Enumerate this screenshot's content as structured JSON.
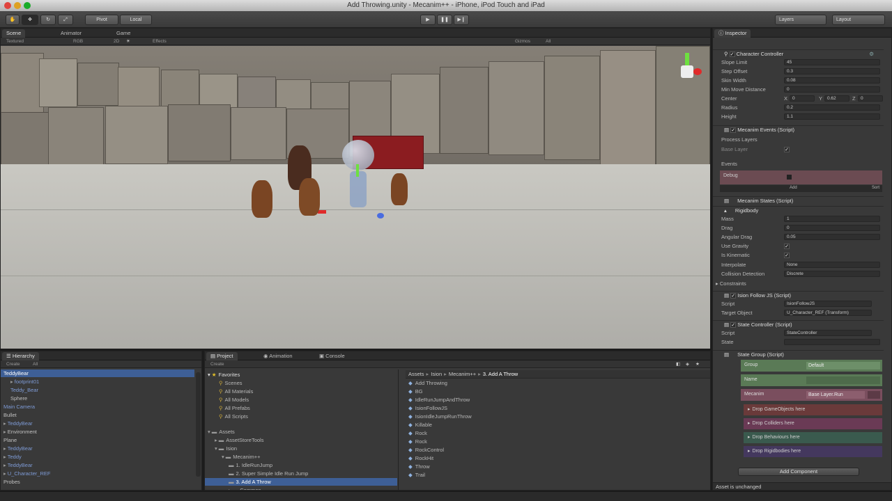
{
  "window": {
    "title": "Add Throwing.unity - Mecanim++ - iPhone, iPod Touch and iPad"
  },
  "toolbar": {
    "pivot_label": "Pivot",
    "local_label": "Local",
    "layers_label": "Layers",
    "layout_label": "Layout"
  },
  "scene_view": {
    "tabs": [
      "Scene",
      "Animator",
      "Game"
    ],
    "shading_mode": "Textured",
    "render_mode": "RGB",
    "mode_2d": "2D",
    "effects_label": "Effects",
    "gizmos_label": "Gizmos",
    "search_placeholder": "All"
  },
  "hierarchy": {
    "tab": "Hierarchy",
    "create_label": "Create",
    "search_placeholder": "All",
    "items": [
      {
        "label": "TeddyBear",
        "selected": true,
        "prefab": false,
        "arrow": "",
        "indent": 0
      },
      {
        "label": "footprint01",
        "selected": false,
        "prefab": true,
        "arrow": "▸",
        "indent": 1
      },
      {
        "label": "Teddy_Bear",
        "selected": false,
        "prefab": true,
        "arrow": "",
        "indent": 1
      },
      {
        "label": "Sphere",
        "selected": false,
        "prefab": false,
        "arrow": "",
        "indent": 1
      },
      {
        "label": "Main Camera",
        "selected": false,
        "prefab": true,
        "arrow": "",
        "indent": 0
      },
      {
        "label": "Bullet",
        "selected": false,
        "prefab": false,
        "arrow": "",
        "indent": 0
      },
      {
        "label": "TeddyBear",
        "selected": false,
        "prefab": true,
        "arrow": "▸",
        "indent": 0
      },
      {
        "label": "Environment",
        "selected": false,
        "prefab": false,
        "arrow": "▸",
        "indent": 0
      },
      {
        "label": "Plane",
        "selected": false,
        "prefab": false,
        "arrow": "",
        "indent": 0
      },
      {
        "label": "TeddyBear",
        "selected": false,
        "prefab": true,
        "arrow": "▸",
        "indent": 0
      },
      {
        "label": "Teddy",
        "selected": false,
        "prefab": true,
        "arrow": "▸",
        "indent": 0
      },
      {
        "label": "TeddyBear",
        "selected": false,
        "prefab": true,
        "arrow": "▸",
        "indent": 0
      },
      {
        "label": "U_Character_REF",
        "selected": false,
        "prefab": true,
        "arrow": "▸",
        "indent": 0
      },
      {
        "label": "Probes",
        "selected": false,
        "prefab": false,
        "arrow": "",
        "indent": 0
      }
    ]
  },
  "project": {
    "tabs": [
      "Project",
      "Animation",
      "Console"
    ],
    "create_label": "Create",
    "favorites_label": "Favorites",
    "favorites": [
      "Scenes",
      "All Materials",
      "All Models",
      "All Prefabs",
      "All Scripts"
    ],
    "tree": [
      {
        "label": "Assets",
        "indent": 0,
        "arrow": "▾",
        "selected": false
      },
      {
        "label": "AssetStoreTools",
        "indent": 1,
        "arrow": "▸",
        "selected": false
      },
      {
        "label": "Ision",
        "indent": 1,
        "arrow": "▾",
        "selected": false
      },
      {
        "label": "Mecanim++",
        "indent": 2,
        "arrow": "▾",
        "selected": false
      },
      {
        "label": "1. IdleRunJump",
        "indent": 3,
        "arrow": "",
        "selected": false
      },
      {
        "label": "2. Super Simple Idle Run Jump",
        "indent": 3,
        "arrow": "",
        "selected": false
      },
      {
        "label": "3. Add A Throw",
        "indent": 3,
        "arrow": "",
        "selected": true
      },
      {
        "label": "Common",
        "indent": 3,
        "arrow": "▸",
        "selected": false
      }
    ],
    "breadcrumb": [
      "Assets",
      "Ision",
      "Mecanim++",
      "3. Add A Throw"
    ],
    "files": [
      "Add Throwing",
      "BG",
      "IdleRunJumpAndThrow",
      "IsionFollowJS",
      "IsionIdleJumpRunThrow",
      "Killable",
      "Rock",
      "Rock",
      "RockControl",
      "RockHit",
      "Throw",
      "Trail"
    ]
  },
  "inspector": {
    "tab": "Inspector",
    "character_controller": {
      "title": "Character Controller",
      "fields": [
        {
          "label": "Slope Limit",
          "value": "45"
        },
        {
          "label": "Step Offset",
          "value": "0.3"
        },
        {
          "label": "Skin Width",
          "value": "0.08"
        },
        {
          "label": "Min Move Distance",
          "value": "0"
        }
      ],
      "center_label": "Center",
      "center": {
        "x_label": "X",
        "x": "0",
        "y_label": "Y",
        "y": "0.62",
        "z_label": "Z",
        "z": "0"
      },
      "radius_label": "Radius",
      "radius": "0.2",
      "height_label": "Height",
      "height": "1.1"
    },
    "mecanim_events": {
      "title": "Mecanim Events (Script)",
      "process_layers_label": "Process Layers",
      "base_layer_label": "Base Layer",
      "events_label": "Events",
      "debug_label": "Debug",
      "add_label": "Add",
      "sort_label": "Sort"
    },
    "mecanim_states": {
      "title": "Mecanim States (Script)"
    },
    "rigidbody": {
      "title": "Rigidbody",
      "fields": [
        {
          "label": "Mass",
          "value": "1"
        },
        {
          "label": "Drag",
          "value": "0"
        },
        {
          "label": "Angular Drag",
          "value": "0.05"
        }
      ],
      "use_gravity_label": "Use Gravity",
      "is_kinematic_label": "Is Kinematic",
      "interpolate_label": "Interpolate",
      "interpolate": "None",
      "collision_label": "Collision Detection",
      "collision": "Discrete",
      "constraints_label": "Constraints"
    },
    "ision_follow": {
      "title": "Ision Follow JS (Script)",
      "script_label": "Script",
      "script": "IsionFollowJS",
      "target_label": "Target Object",
      "target": "U_Character_REF (Transform)"
    },
    "state_controller": {
      "title": "State Controller (Script)",
      "script_label": "Script",
      "script": "StateController",
      "state_label": "State"
    },
    "state_group": {
      "title": "State Group (Script)",
      "group_label": "Group",
      "group_value": "Default",
      "name_label": "Name",
      "mecanim_label": "Mecanim",
      "mecanim_value": "Base Layer.Run",
      "drops": [
        {
          "label": "Drop GameObjects here",
          "color": "#6a3a3a"
        },
        {
          "label": "Drop Colliders here",
          "color": "#6a3a55"
        },
        {
          "label": "Drop Behaviours here",
          "color": "#3a5a4e"
        },
        {
          "label": "Drop Rigidbodies here",
          "color": "#44385e"
        }
      ]
    },
    "add_component_label": "Add Component",
    "status": "Asset is unchanged"
  },
  "colors": {
    "selection": "#3e5f96",
    "prefab_text": "#7e9bd6",
    "panel": "#393939"
  }
}
